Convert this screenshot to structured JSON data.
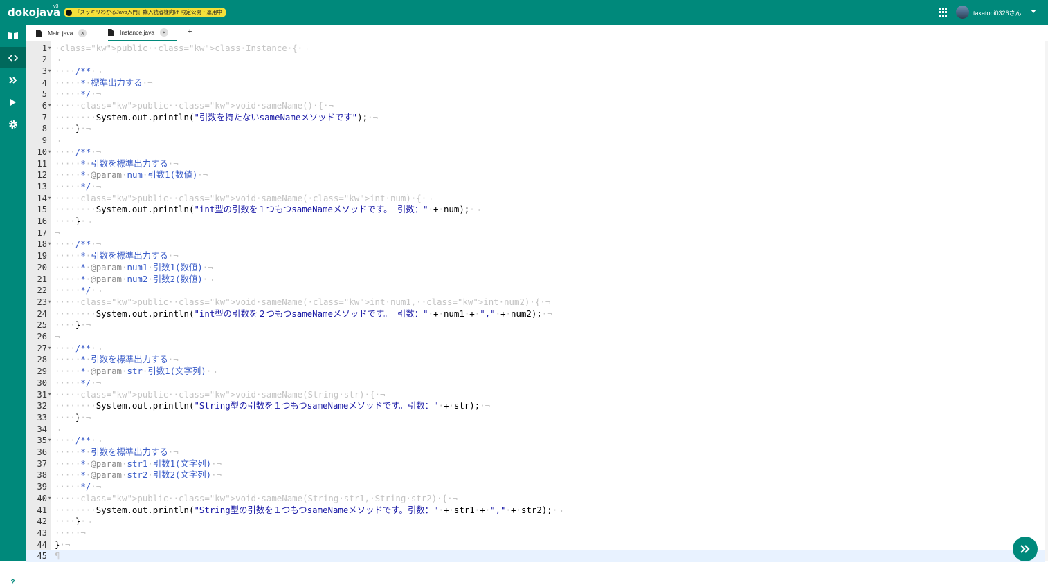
{
  "header": {
    "logo": "dokojava",
    "version": "v3",
    "notice": "『スッキリわかるJava入門』購入読者様向け 限定公開・運用中",
    "username": "takatobi0326さん"
  },
  "tabs": [
    {
      "label": "Main.java",
      "active": false
    },
    {
      "label": "Instance.java",
      "active": true
    }
  ],
  "add_tab": "+",
  "editor": {
    "current_line": 45,
    "lines": [
      "public class Instance {",
      "",
      "    /**",
      "     * 標準出力する",
      "     */",
      "    public void sameName() {",
      "        System.out.println(\"引数を持たないsameNameメソッドです\");",
      "    }",
      "",
      "    /**",
      "     * 引数を標準出力する",
      "     * @param num 引数1(数値)",
      "     */",
      "    public void sameName(int num) {",
      "        System.out.println(\"int型の引数を１つもつsameNameメソッドです。 引数：\" + num);",
      "    }",
      "",
      "    /**",
      "     * 引数を標準出力する",
      "     * @param num1 引数1(数値)",
      "     * @param num2 引数2(数値)",
      "     */",
      "    public void sameName(int num1, int num2) {",
      "        System.out.println(\"int型の引数を２つもつsameNameメソッドです。 引数：\" + num1 + \",\" + num2);",
      "    }",
      "",
      "    /**",
      "     * 引数を標準出力する",
      "     * @param str 引数1(文字列)",
      "     */",
      "    public void sameName(String str) {",
      "        System.out.println(\"String型の引数を１つもつsameNameメソッドです。引数：\" + str);",
      "    }",
      "",
      "    /**",
      "     * 引数を標準出力する",
      "     * @param str1 引数1(文字列)",
      "     * @param str2 引数2(文字列)",
      "     */",
      "    public void sameName(String str1, String str2) {",
      "        System.out.println(\"String型の引数を１つもつsameNameメソッドです。引数：\" + str1 + \",\" + str2);",
      "    }",
      "    ",
      "}",
      ""
    ],
    "fold_lines": [
      1,
      3,
      6,
      10,
      14,
      18,
      23,
      27,
      31,
      35,
      40
    ]
  },
  "colors": {
    "brand": "#00897b",
    "notice_bg": "#f5e03a"
  },
  "icons": {
    "sidebar": [
      "book-icon",
      "code-icon",
      "double-chevron-icon",
      "play-icon",
      "gear-icon"
    ],
    "fab": "double-chevron-icon"
  }
}
